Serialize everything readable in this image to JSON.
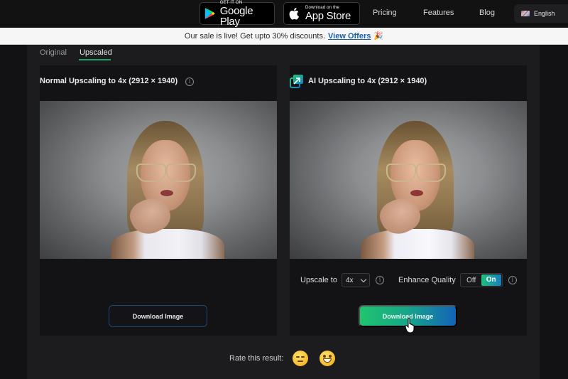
{
  "topbar": {
    "google_play": {
      "small": "GET IT ON",
      "big": "Google Play",
      "icon": "google-play-icon"
    },
    "app_store": {
      "small": "Download on the",
      "big": "App Store",
      "icon": "apple-icon"
    },
    "nav": [
      "Pricing",
      "Features",
      "Blog"
    ],
    "language": {
      "label": "English",
      "icon": "uk-flag-icon"
    }
  },
  "banner": {
    "text": "Our sale is live! Get upto 30% discounts.",
    "link": "View Offers",
    "emoji": "🎉"
  },
  "tabs": [
    {
      "label": "Original",
      "active": false
    },
    {
      "label": "Upscaled",
      "active": true
    }
  ],
  "left_panel": {
    "title": "Normal Upscaling to 4x (2912 × 1940)",
    "info": "i",
    "download_label": "Download Image"
  },
  "right_panel": {
    "title": "AI Upscaling to 4x (2912 × 1940)",
    "icon": "ai-upscale-icon",
    "upscale_label": "Upscale to",
    "upscale_value": "4x",
    "enhance_label": "Enhance Quality",
    "toggle_off": "Off",
    "toggle_on": "On",
    "enhance_state": "On",
    "info": "i",
    "download_label": "Download Image"
  },
  "rating": {
    "label": "Rate this result:",
    "options": [
      "sad-face",
      "happy-face"
    ]
  },
  "colors": {
    "accent_green": "#1ea36a",
    "gradient_start": "#1fc46e",
    "gradient_end": "#1463b8",
    "link_blue": "#1b5fa8"
  }
}
